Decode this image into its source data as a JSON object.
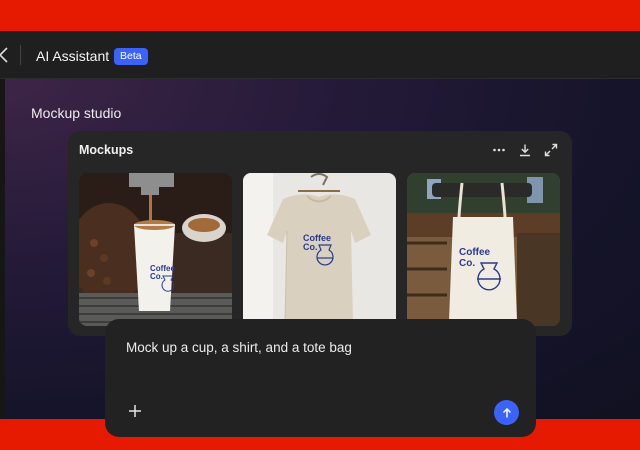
{
  "header": {
    "back_icon": "chevron-left-icon",
    "title": "AI Assistant",
    "badge": "Beta"
  },
  "main": {
    "section_title": "Mockup studio",
    "card": {
      "title": "Mockups",
      "actions": [
        "more-icon",
        "download-icon",
        "expand-icon"
      ],
      "mockups": [
        {
          "item": "cup",
          "logo_line1": "Coffee",
          "logo_line2": "Co."
        },
        {
          "item": "shirt",
          "logo_line1": "Coffee",
          "logo_line2": "Co."
        },
        {
          "item": "tote bag",
          "logo_line1": "Coffee",
          "logo_line2": "Co."
        }
      ]
    }
  },
  "prompt": {
    "text": "Mock up a cup, a shirt, and a tote bag",
    "add_icon": "plus-icon",
    "send_icon": "arrow-up-icon"
  },
  "colors": {
    "accent": "#3b63fb",
    "brand_frame": "#e61a00",
    "logo_ink": "#2b3a8f"
  }
}
